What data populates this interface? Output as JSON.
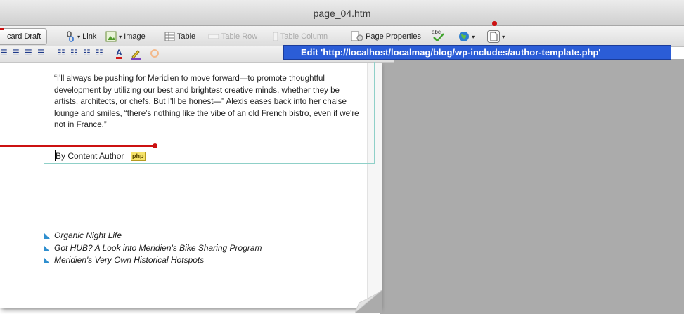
{
  "window": {
    "title": "page_04.htm"
  },
  "toolbar": {
    "draft_label": "card Draft",
    "link_label": "Link",
    "image_label": "Image",
    "table_label": "Table",
    "table_row_label": "Table Row",
    "table_column_label": "Table Column",
    "page_properties_label": "Page Properties",
    "spell_icon_text": "abc"
  },
  "tooltip": {
    "text": "Edit 'http://localhost/localmag/blog/wp-includes/author-template.php'"
  },
  "content": {
    "quote": "“I'll always be pushing for Meridien to move forward—to promote thoughtful development by utilizing our best and brightest creative minds, whether they be artists, architects, or chefs. But I'll be honest—” Alexis eases back into her chaise lounge and smiles, “there's nothing like the vibe of an old French bistro, even if we're not in France.”",
    "byline": "By Content Author",
    "php_badge": "php"
  },
  "related_links": [
    "Organic Night Life",
    "Got HUB? A Look into Meridien's Bike Sharing Program",
    "Meridien's Very Own Historical Hotspots"
  ],
  "colors": {
    "tooltip_bg": "#2b5dd7",
    "callout": "#cc1111",
    "divider": "#59c6e6",
    "bullet": "#2f8fcf"
  }
}
